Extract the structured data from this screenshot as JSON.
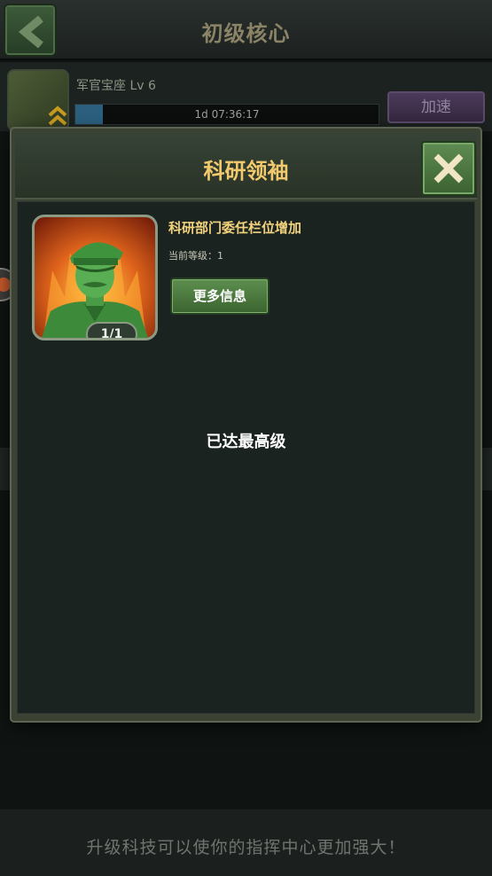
{
  "screen": {
    "title": "初级核心",
    "building_name": "军官宝座 Lv 6",
    "timer": "1d 07:36:17",
    "timer_progress": 0.09,
    "speed_up_label": "加速",
    "footer_text": "升级科技可以使你的指挥中心更加强大！"
  },
  "modal": {
    "title": "科研领袖",
    "tech_name": "科研部门委任栏位增加",
    "current_level_label": "当前等级：1",
    "level_badge": "1/1",
    "more_info_label": "更多信息",
    "max_level_text": "已达最高级"
  },
  "icons": {
    "back": "chevron-left-icon",
    "close": "close-x-icon",
    "portrait": "army-officer-portrait",
    "side_tab": "side-tab-icon"
  },
  "colors": {
    "title_gold": "#f2ca6d",
    "button_green": "#4e7b41",
    "speed_purple": "#4b3a5a"
  }
}
